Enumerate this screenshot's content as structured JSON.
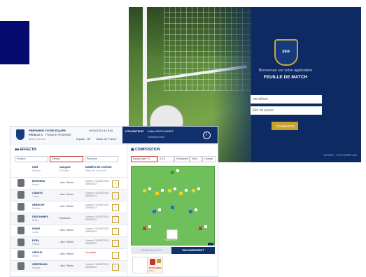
{
  "login": {
    "welcome": "Bienvenue sur votre application",
    "app_title": "FEUILLE DE MATCH",
    "logo_text": "FFF",
    "id_placeholder": "Identifiant",
    "pw_placeholder": "Mot de passe",
    "connect_label": "CONNEXION",
    "version": "version : 2.8.0.1009-xxx"
  },
  "app": {
    "header": {
      "title": "PRÉPARER VOTRE ÉQUIPE",
      "breadcrumb_1": "FEUILLE 1",
      "breadcrumb_2": "FRANCE FEMININE",
      "sub": "Match amical",
      "date": "09/06/2013 à 19:45",
      "equipe": "Equipe : BF",
      "stade": "Stade de France",
      "user_label": "UTILISATEUR",
      "user_name": "Didier DESCHAMPS",
      "user_role": "Sélectionneur",
      "info": "i"
    },
    "effectif": {
      "title": "EFFECTIF",
      "filters": [
        "Position",
        "Groupe",
        "Personne"
      ],
      "headers": {
        "nom": "NOM",
        "prenom": "Prénom",
        "categorie": "Catégorie",
        "fonction": "Fonction",
        "licence": "NUMÉRO DE LICENCE",
        "statut": "Statut de la licence"
      },
      "rows": [
        {
          "nom": "BORDERA",
          "prenom": "Benoit",
          "cat": "Libre / Senior",
          "lic": "Licence n°1424372018",
          "lic2": "09/06/2013",
          "red": false
        },
        {
          "nom": "CABAYE",
          "prenom": "Yohan",
          "cat": "Libre / Senior",
          "lic": "Licence n°1424372018",
          "lic2": "09/06/2013",
          "red": false
        },
        {
          "nom": "DEBUCHY",
          "prenom": "Mathieu",
          "cat": "Libre / Senior",
          "lic": "Licence n°1424372018",
          "lic2": "22/08/2013",
          "red": false
        },
        {
          "nom": "DESCHAMPS",
          "prenom": "Didier",
          "cat": "Entraîneur",
          "lic": "Licence n°1424372018",
          "lic2": "09/06/2013",
          "red": false
        },
        {
          "nom": "DIGNE",
          "prenom": "Lucas",
          "cat": "Libre / Senior",
          "lic": "Licence n°1424372018",
          "lic2": "09/06/2013",
          "red": false
        },
        {
          "nom": "EVRA",
          "prenom": "Patrice",
          "cat": "Libre / Senior",
          "lic": "Licence n°1424372018",
          "lic2": "09/06/2013",
          "red": false
        },
        {
          "nom": "GIROUD",
          "prenom": "Olivier",
          "cat": "Libre / Senior",
          "lic": "Incomplète",
          "lic2": "",
          "red": true
        },
        {
          "nom": "GRIEZMANN",
          "prenom": "Antoine",
          "cat": "Libre / Senior",
          "lic": "Licence n°1424372018",
          "lic2": "09/06/2013",
          "red": false
        }
      ]
    },
    "composition": {
      "title": "COMPOSITION",
      "selects": [
        "Equipe type n°1",
        "4-3-3"
      ],
      "buttons": [
        "Enregistrer",
        "Vider",
        "Charger"
      ],
      "add_label": "+ AJOUTER",
      "tabs": [
        "REMPLAÇANTS",
        "ENCADREMENT"
      ],
      "staff_name": "DESCHAMPS",
      "staff_first": "Didier"
    }
  }
}
